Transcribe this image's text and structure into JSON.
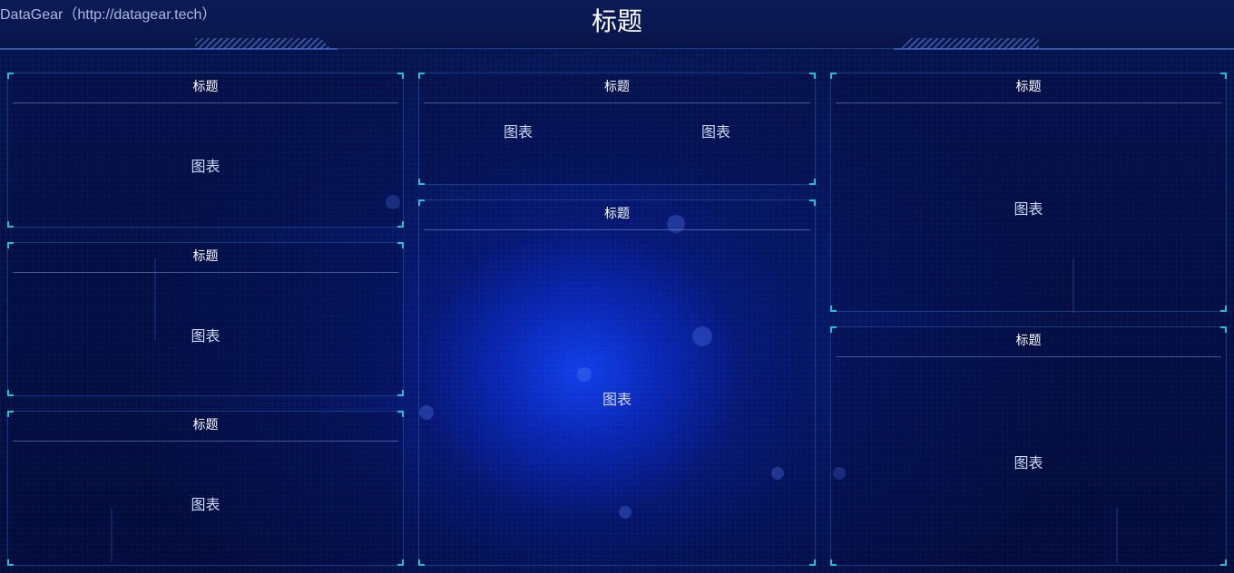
{
  "header": {
    "brand": "DataGear（http://datagear.tech）",
    "title": "标题"
  },
  "panels": {
    "left": [
      {
        "title": "标题",
        "chart": "图表"
      },
      {
        "title": "标题",
        "chart": "图表"
      },
      {
        "title": "标题",
        "chart": "图表"
      }
    ],
    "middle_top": {
      "title": "标题",
      "charts": [
        "图表",
        "图表"
      ]
    },
    "middle_main": {
      "title": "标题",
      "chart": "图表"
    },
    "right": [
      {
        "title": "标题",
        "chart": "图表"
      },
      {
        "title": "标题",
        "chart": "图表"
      }
    ]
  },
  "colors": {
    "accent_corner": "#1ec3d8",
    "background": "#041046",
    "glow": "#1446ff"
  }
}
